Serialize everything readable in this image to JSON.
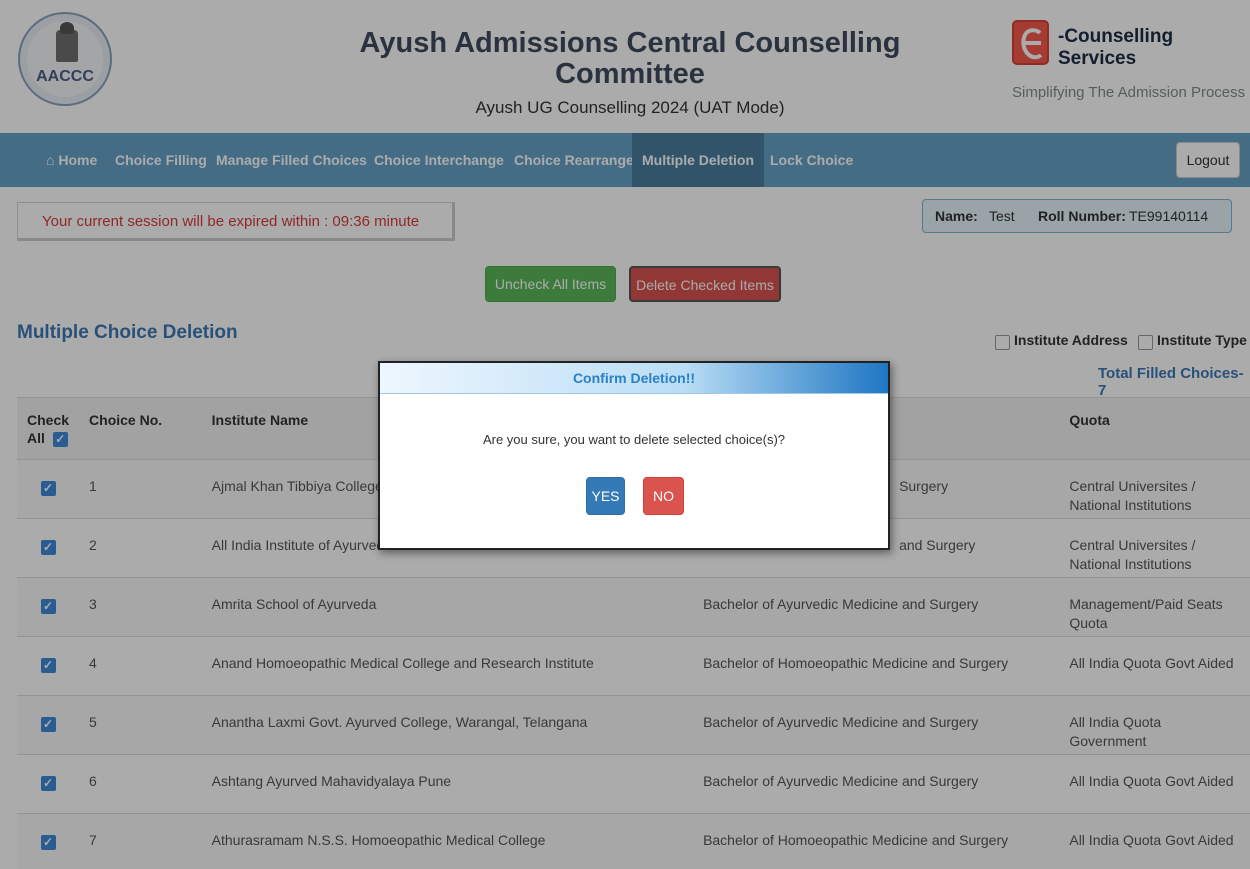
{
  "header": {
    "left_logo_text": "AACCC",
    "title_line1": "Ayush Admissions Central Counselling",
    "title_line2": "Committee",
    "subtitle": "Ayush UG Counselling 2024 (UAT Mode)",
    "right_brand_text": "-Counselling Services",
    "right_slogan": "Simplifying The Admission Process",
    "right_logo_letter": "e"
  },
  "nav": {
    "items": [
      {
        "label": "Home",
        "icon": "home-icon"
      },
      {
        "label": "Choice Filling"
      },
      {
        "label": "Manage Filled Choices"
      },
      {
        "label": "Choice Interchange"
      },
      {
        "label": "Choice Rearrange"
      },
      {
        "label": "Multiple Deletion",
        "active": true
      },
      {
        "label": "Lock Choice"
      }
    ],
    "logout": "Logout"
  },
  "session": {
    "message": "Your current session will be expired within : 09:36 minute"
  },
  "user": {
    "name_label": "Name:",
    "name_value": "Test",
    "roll_label": "Roll Number:",
    "roll_value": "TE99140114"
  },
  "actions": {
    "uncheck_all": "Uncheck All Items",
    "delete_checked": "Delete Checked Items"
  },
  "section": {
    "title": "Multiple Choice Deletion",
    "filter_address": "Institute Address",
    "filter_type": "Institute Type",
    "total": "Total Filled Choices-7"
  },
  "table": {
    "headers": {
      "check": "Check",
      "all": "All",
      "choice_no": "Choice No.",
      "institute": "Institute Name",
      "course": "",
      "quota": "Quota"
    },
    "rows": [
      {
        "no": "1",
        "institute": "Ajmal Khan Tibbiya College,",
        "course": "Surgery",
        "quota": "Central Universites / National Institutions"
      },
      {
        "no": "2",
        "institute": "All India Institute of Ayurved",
        "course": "and Surgery",
        "quota": "Central Universites / National Institutions"
      },
      {
        "no": "3",
        "institute": "Amrita School of Ayurveda",
        "course": "Bachelor of Ayurvedic Medicine and Surgery",
        "quota": "Management/Paid Seats Quota"
      },
      {
        "no": "4",
        "institute": "Anand Homoeopathic Medical College and Research Institute",
        "course": "Bachelor of Homoeopathic Medicine and Surgery",
        "quota": "All India Quota Govt Aided"
      },
      {
        "no": "5",
        "institute": "Anantha Laxmi Govt. Ayurved College, Warangal, Telangana",
        "course": "Bachelor of Ayurvedic Medicine and Surgery",
        "quota": "All India Quota Government"
      },
      {
        "no": "6",
        "institute": "Ashtang Ayurved Mahavidyalaya Pune",
        "course": "Bachelor of Ayurvedic Medicine and Surgery",
        "quota": "All India Quota Govt Aided"
      },
      {
        "no": "7",
        "institute": "Athurasramam N.S.S. Homoeopathic Medical College",
        "course": "Bachelor of Homoeopathic Medicine and Surgery",
        "quota": "All India Quota Govt Aided"
      }
    ]
  },
  "modal": {
    "title": "Confirm Deletion!!",
    "message": "Are you sure, you want to delete selected choice(s)?",
    "yes": "YES",
    "no": "NO"
  },
  "colors": {
    "nav": "#66a3c6",
    "nav_active": "#4b7ea0",
    "accent_blue": "#3d7ab7",
    "danger": "#d9534f",
    "success": "#5cb85c",
    "checkbox": "#3e8ad8"
  }
}
